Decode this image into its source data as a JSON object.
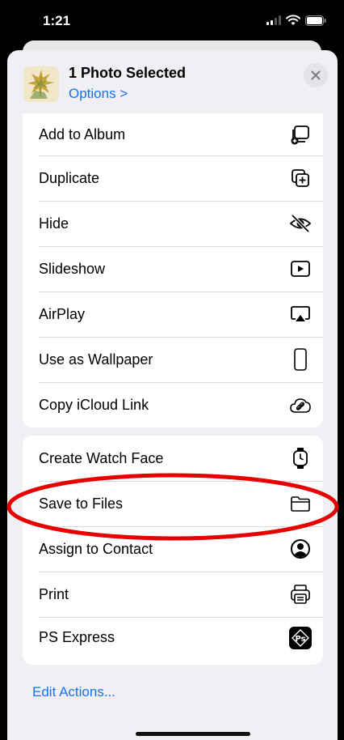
{
  "status_bar": {
    "time": "1:21",
    "icons": [
      "cellular-signal-icon",
      "wifi-icon",
      "battery-icon"
    ]
  },
  "header": {
    "title": "1 Photo Selected",
    "options_label": "Options >",
    "close_icon": "close-icon"
  },
  "actions_group_1": [
    {
      "label": "Add to Album",
      "icon": "add-to-album-icon"
    },
    {
      "label": "Duplicate",
      "icon": "duplicate-icon"
    },
    {
      "label": "Hide",
      "icon": "eye-slash-icon"
    },
    {
      "label": "Slideshow",
      "icon": "play-icon"
    },
    {
      "label": "AirPlay",
      "icon": "airplay-icon"
    },
    {
      "label": "Use as Wallpaper",
      "icon": "phone-icon"
    },
    {
      "label": "Copy iCloud Link",
      "icon": "link-icon"
    }
  ],
  "actions_group_2": [
    {
      "label": "Create Watch Face",
      "icon": "watch-icon"
    },
    {
      "label": "Save to Files",
      "icon": "folder-icon"
    },
    {
      "label": "Assign to Contact",
      "icon": "person-circle-icon"
    },
    {
      "label": "Print",
      "icon": "printer-icon"
    },
    {
      "label": "PS Express",
      "icon": "ps-express-app-icon"
    }
  ],
  "footer": {
    "edit_actions_label": "Edit Actions..."
  },
  "colors": {
    "link_blue": "#1a73e8",
    "highlight_red": "#e60000",
    "sheet_background": "#efeff4"
  }
}
